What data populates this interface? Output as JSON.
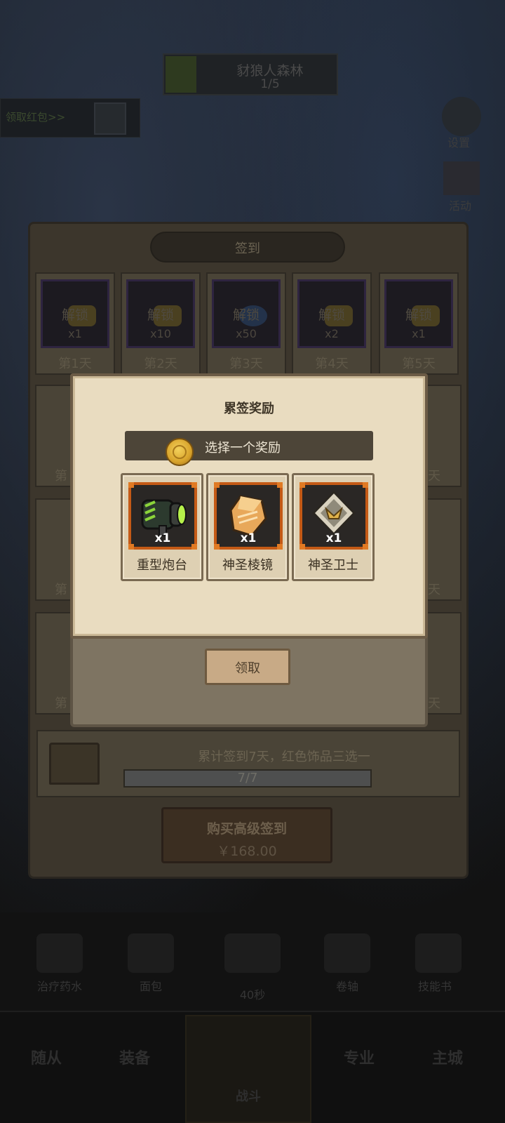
{
  "background": {
    "stage_name": "豺狼人森林",
    "stage_progress": "1/5",
    "left_button": "领取红包>>",
    "settings_label": "设置",
    "activity_label": "活动",
    "items": [
      {
        "label": "治疗药水"
      },
      {
        "label": "面包"
      },
      {
        "label": "40秒"
      },
      {
        "label": "卷轴"
      },
      {
        "label": "技能书"
      }
    ],
    "nav": [
      {
        "label": "随从"
      },
      {
        "label": "装备"
      },
      {
        "label": "战斗"
      },
      {
        "label": "专业"
      },
      {
        "label": "主城"
      }
    ]
  },
  "signin": {
    "title": "签到",
    "days": [
      {
        "lock": "解锁",
        "qty": "x1",
        "day": "第1天"
      },
      {
        "lock": "解锁",
        "qty": "x10",
        "day": "第2天"
      },
      {
        "lock": "解锁",
        "qty": "x50",
        "day": "第3天"
      },
      {
        "lock": "解锁",
        "qty": "x2",
        "day": "第4天"
      },
      {
        "lock": "解锁",
        "qty": "x1",
        "day": "第5天"
      }
    ],
    "partial_left": [
      "第",
      "第",
      "第"
    ],
    "partial_right": [
      "天",
      "天",
      "天"
    ],
    "cumulative_text": "累计签到7天，红色饰品三选一",
    "progress_text": "7/7",
    "progress_value": 1.0,
    "buy_label": "购买高级签到",
    "buy_price": "￥168.00"
  },
  "popup": {
    "title": "累签奖励",
    "choose_text": "选择一个奖励",
    "rewards": [
      {
        "name": "重型炮台",
        "qty": "x1",
        "icon": "turret-icon"
      },
      {
        "name": "神圣棱镜",
        "qty": "x1",
        "icon": "prism-icon"
      },
      {
        "name": "神圣卫士",
        "qty": "x1",
        "icon": "guardian-icon"
      }
    ],
    "claim_label": "领取"
  }
}
